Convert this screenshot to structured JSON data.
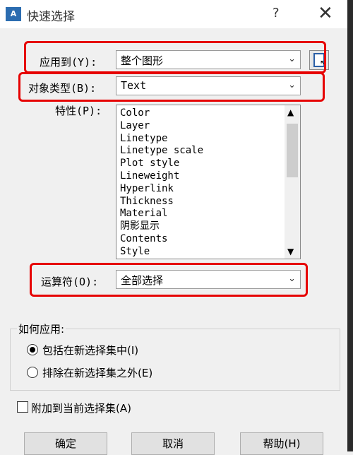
{
  "window": {
    "app_icon_text": "A",
    "title": "快速选择",
    "help_label": "?",
    "close_label": "✕"
  },
  "apply_to": {
    "label": "应用到(Y):",
    "value": "整个图形"
  },
  "object_type": {
    "label": "对象类型(B):",
    "value": "Text"
  },
  "properties": {
    "label": "特性(P):",
    "items": [
      "Color",
      "Layer",
      "Linetype",
      "Linetype scale",
      "Plot style",
      "Lineweight",
      "Hyperlink",
      "Thickness",
      "Material",
      "阴影显示",
      "Contents",
      "Style"
    ]
  },
  "operator": {
    "label": "运算符(O):",
    "value": "全部选择"
  },
  "how_to_apply": {
    "label": "如何应用:",
    "include_label": "包括在新选择集中(I)",
    "exclude_label": "排除在新选择集之外(E)"
  },
  "append": {
    "label": "附加到当前选择集(A)"
  },
  "buttons": {
    "ok": "确定",
    "cancel": "取消",
    "help": "帮助(H)"
  },
  "icons": {
    "dropdown": "chevron-down-icon",
    "select_objects": "select-objects-icon"
  },
  "colors": {
    "highlight": "#e60000"
  }
}
